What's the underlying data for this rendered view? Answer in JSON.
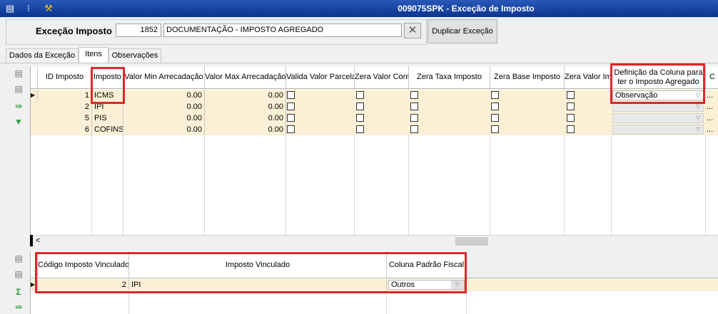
{
  "window": {
    "title": "009075SPK - Exceção de Imposto",
    "icons": [
      "menu-icon",
      "traffic-light-icon",
      "tools-icon"
    ]
  },
  "header": {
    "label": "Exceção Imposto",
    "code": "1852",
    "description": "DOCUMENTAÇÃO - IMPOSTO AGREGADO",
    "clear_glyph": "✕",
    "duplicate_button": "Duplicar Exceção"
  },
  "tabs": [
    "Dados da Exceção",
    "Itens",
    "Observações"
  ],
  "active_tab": "Itens",
  "items_grid": {
    "columns": [
      "ID Imposto",
      "Imposto",
      "Valor Min Arrecadação",
      "Valor Max Arrecadação",
      "Valida Valor Parcela",
      "Zera Valor Conta",
      "Zera Taxa Imposto",
      "Zera Base Imposto",
      "Zera Valor Im",
      "Definição da Coluna para ter o Imposto Agregado",
      "C"
    ],
    "rows": [
      {
        "id": "1",
        "imposto": "ICMS",
        "min": "0.00",
        "max": "0.00",
        "definicao": "Observação",
        "extra": "..."
      },
      {
        "id": "2",
        "imposto": "IPI",
        "min": "0.00",
        "max": "0.00",
        "definicao": "",
        "extra": "..."
      },
      {
        "id": "5",
        "imposto": "PIS",
        "min": "0.00",
        "max": "0.00",
        "definicao": "",
        "extra": "..."
      },
      {
        "id": "6",
        "imposto": "COFINS",
        "min": "0.00",
        "max": "0.00",
        "definicao": "",
        "extra": "..."
      }
    ],
    "scroll_left_glyph": "<"
  },
  "linked_grid": {
    "columns": [
      "Código Imposto Vinculado",
      "Imposto Vinculado",
      "Coluna Padrão Fiscal"
    ],
    "rows": [
      {
        "codigo": "2",
        "imposto": "IPI",
        "coluna": "Outros"
      }
    ]
  },
  "colors": {
    "titlebar": "#0a3590",
    "row_fill": "#fbf0d6",
    "highlight": "#e0262a"
  }
}
